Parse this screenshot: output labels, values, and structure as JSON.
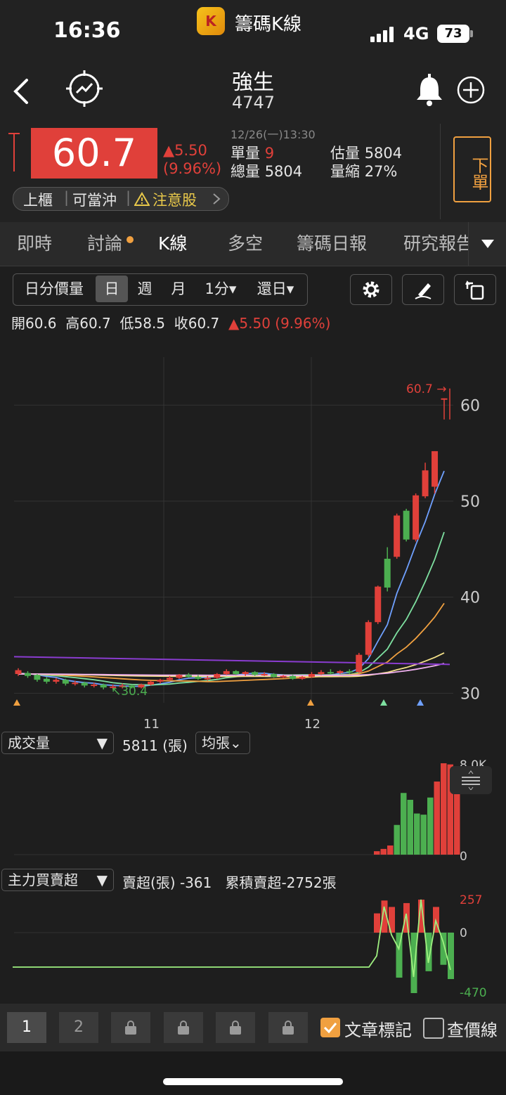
{
  "status_bar": {
    "time": "16:36",
    "app_title": "籌碼K線",
    "network": "4G",
    "battery": "73",
    "app_icon_glyph": "K"
  },
  "stock": {
    "name": "強生",
    "code": "4747"
  },
  "quote": {
    "price": "60.7",
    "change": "▲5.50",
    "change_pct": "(9.96%)",
    "timestamp": "12/26(一)13:30",
    "single_vol_label": "單量",
    "single_vol": "9",
    "total_vol_label": "總量",
    "total_vol": "5804",
    "est_vol_label": "估量",
    "est_vol": "5804",
    "vol_ratio_label": "量縮",
    "vol_ratio": "27%",
    "order_button": "下單",
    "tag_market": "上櫃",
    "tag_daytrade": "可當沖",
    "tag_warning": "注意股"
  },
  "tabs": [
    "即時",
    "討論",
    "K線",
    "多空",
    "籌碼日報",
    "研究報告"
  ],
  "toolbar": {
    "intraday": "日分價量",
    "day": "日",
    "week": "週",
    "month": "月",
    "minute": "1分▾",
    "restore": "還日▾"
  },
  "ohlc": {
    "open_label": "開",
    "open": "60.6",
    "high_label": "高",
    "high": "60.7",
    "low_label": "低",
    "low": "58.5",
    "close_label": "收",
    "close": "60.7",
    "change": "▲5.50 (9.96%)"
  },
  "chart_data": {
    "type": "candlestick",
    "y_ticks": [
      "60",
      "50",
      "40",
      "30"
    ],
    "ylim": [
      29,
      65
    ],
    "x_ticks": [
      "11",
      "12"
    ],
    "price_marker": "60.7",
    "low_marker": "30.4",
    "candles": [
      {
        "o": 32.0,
        "c": 32.4,
        "h": 32.6,
        "l": 31.8
      },
      {
        "o": 32.1,
        "c": 31.8,
        "h": 32.3,
        "l": 31.6
      },
      {
        "o": 31.9,
        "c": 31.4,
        "h": 32.0,
        "l": 31.2
      },
      {
        "o": 31.5,
        "c": 31.2,
        "h": 31.7,
        "l": 31.0
      },
      {
        "o": 31.2,
        "c": 31.4,
        "h": 31.6,
        "l": 31.0
      },
      {
        "o": 31.4,
        "c": 31.0,
        "h": 31.5,
        "l": 30.8
      },
      {
        "o": 31.0,
        "c": 31.1,
        "h": 31.3,
        "l": 30.8
      },
      {
        "o": 31.1,
        "c": 30.8,
        "h": 31.2,
        "l": 30.6
      },
      {
        "o": 30.8,
        "c": 30.9,
        "h": 31.1,
        "l": 30.6
      },
      {
        "o": 30.9,
        "c": 30.6,
        "h": 31.0,
        "l": 30.4
      },
      {
        "o": 30.6,
        "c": 30.7,
        "h": 30.9,
        "l": 30.4
      },
      {
        "o": 30.7,
        "c": 30.8,
        "h": 31.0,
        "l": 30.5
      },
      {
        "o": 30.8,
        "c": 30.6,
        "h": 30.9,
        "l": 30.5
      },
      {
        "o": 30.6,
        "c": 30.9,
        "h": 31.0,
        "l": 30.5
      },
      {
        "o": 30.9,
        "c": 31.2,
        "h": 31.3,
        "l": 30.8
      },
      {
        "o": 31.2,
        "c": 31.4,
        "h": 31.5,
        "l": 31.0
      },
      {
        "o": 31.4,
        "c": 31.6,
        "h": 31.8,
        "l": 31.3
      },
      {
        "o": 31.6,
        "c": 31.9,
        "h": 32.0,
        "l": 31.5
      },
      {
        "o": 31.9,
        "c": 31.7,
        "h": 32.1,
        "l": 31.6
      },
      {
        "o": 31.7,
        "c": 31.5,
        "h": 31.9,
        "l": 31.4
      },
      {
        "o": 31.5,
        "c": 31.6,
        "h": 31.8,
        "l": 31.3
      },
      {
        "o": 31.6,
        "c": 32.0,
        "h": 32.1,
        "l": 31.5
      },
      {
        "o": 32.0,
        "c": 32.3,
        "h": 32.5,
        "l": 31.9
      },
      {
        "o": 32.3,
        "c": 32.0,
        "h": 32.4,
        "l": 31.9
      },
      {
        "o": 32.0,
        "c": 32.2,
        "h": 32.3,
        "l": 31.8
      },
      {
        "o": 32.2,
        "c": 31.9,
        "h": 32.3,
        "l": 31.8
      },
      {
        "o": 31.9,
        "c": 32.0,
        "h": 32.2,
        "l": 31.8
      },
      {
        "o": 32.0,
        "c": 31.7,
        "h": 32.1,
        "l": 31.6
      },
      {
        "o": 31.7,
        "c": 31.8,
        "h": 31.9,
        "l": 31.6
      },
      {
        "o": 31.8,
        "c": 31.5,
        "h": 31.9,
        "l": 31.4
      },
      {
        "o": 31.5,
        "c": 31.7,
        "h": 31.8,
        "l": 31.4
      },
      {
        "o": 31.7,
        "c": 32.0,
        "h": 32.2,
        "l": 31.6
      },
      {
        "o": 32.0,
        "c": 32.2,
        "h": 32.4,
        "l": 31.9
      },
      {
        "o": 32.2,
        "c": 32.1,
        "h": 32.5,
        "l": 32.0
      },
      {
        "o": 32.1,
        "c": 32.3,
        "h": 32.4,
        "l": 32.0
      },
      {
        "o": 32.3,
        "c": 32.2,
        "h": 32.5,
        "l": 32.0
      },
      {
        "o": 32.2,
        "c": 34.0,
        "h": 34.2,
        "l": 32.1
      },
      {
        "o": 34.0,
        "c": 37.4,
        "h": 37.6,
        "l": 33.8
      },
      {
        "o": 37.4,
        "c": 41.1,
        "h": 41.2,
        "l": 37.2
      },
      {
        "o": 44.0,
        "c": 41.0,
        "h": 45.2,
        "l": 40.6
      },
      {
        "o": 44.2,
        "c": 48.5,
        "h": 48.7,
        "l": 44.0
      },
      {
        "o": 49.0,
        "c": 46.0,
        "h": 49.2,
        "l": 45.8
      },
      {
        "o": 46.0,
        "c": 50.6,
        "h": 50.8,
        "l": 45.8
      },
      {
        "o": 50.5,
        "c": 53.2,
        "h": 54.0,
        "l": 50.3
      },
      {
        "o": 51.5,
        "c": 55.2,
        "h": 55.2,
        "l": 50.8
      },
      {
        "o": 60.6,
        "c": 60.7,
        "h": 60.7,
        "l": 58.5
      }
    ],
    "volume": {
      "label": "成交量",
      "value": "5811 (張)",
      "avg_label": "均張",
      "max_label": "8.0K",
      "min_label": "0",
      "values": [
        0.3,
        0.5,
        0.8,
        2.6,
        5.4,
        4.8,
        3.6,
        3.5,
        5.0,
        6.4,
        8.0,
        7.9,
        5.8
      ]
    },
    "main_force": {
      "label": "主力買賣超",
      "sell_label": "賣超(張)",
      "sell_value": "-361",
      "cum_label": "累積賣超",
      "cum_value": "-2752張",
      "max_label": "257",
      "zero_label": "0",
      "min_label": "-470",
      "values": [
        150,
        250,
        200,
        -350,
        230,
        -470,
        257,
        -300,
        200,
        -250,
        -361
      ]
    }
  },
  "bottom_bar": {
    "page1": "1",
    "page2": "2",
    "article_mark": "文章標記",
    "price_line": "查價線"
  },
  "colors": {
    "up": "#e0403a",
    "down": "#4caf50",
    "accent": "#f0a040",
    "bg": "#1e1e1e"
  }
}
